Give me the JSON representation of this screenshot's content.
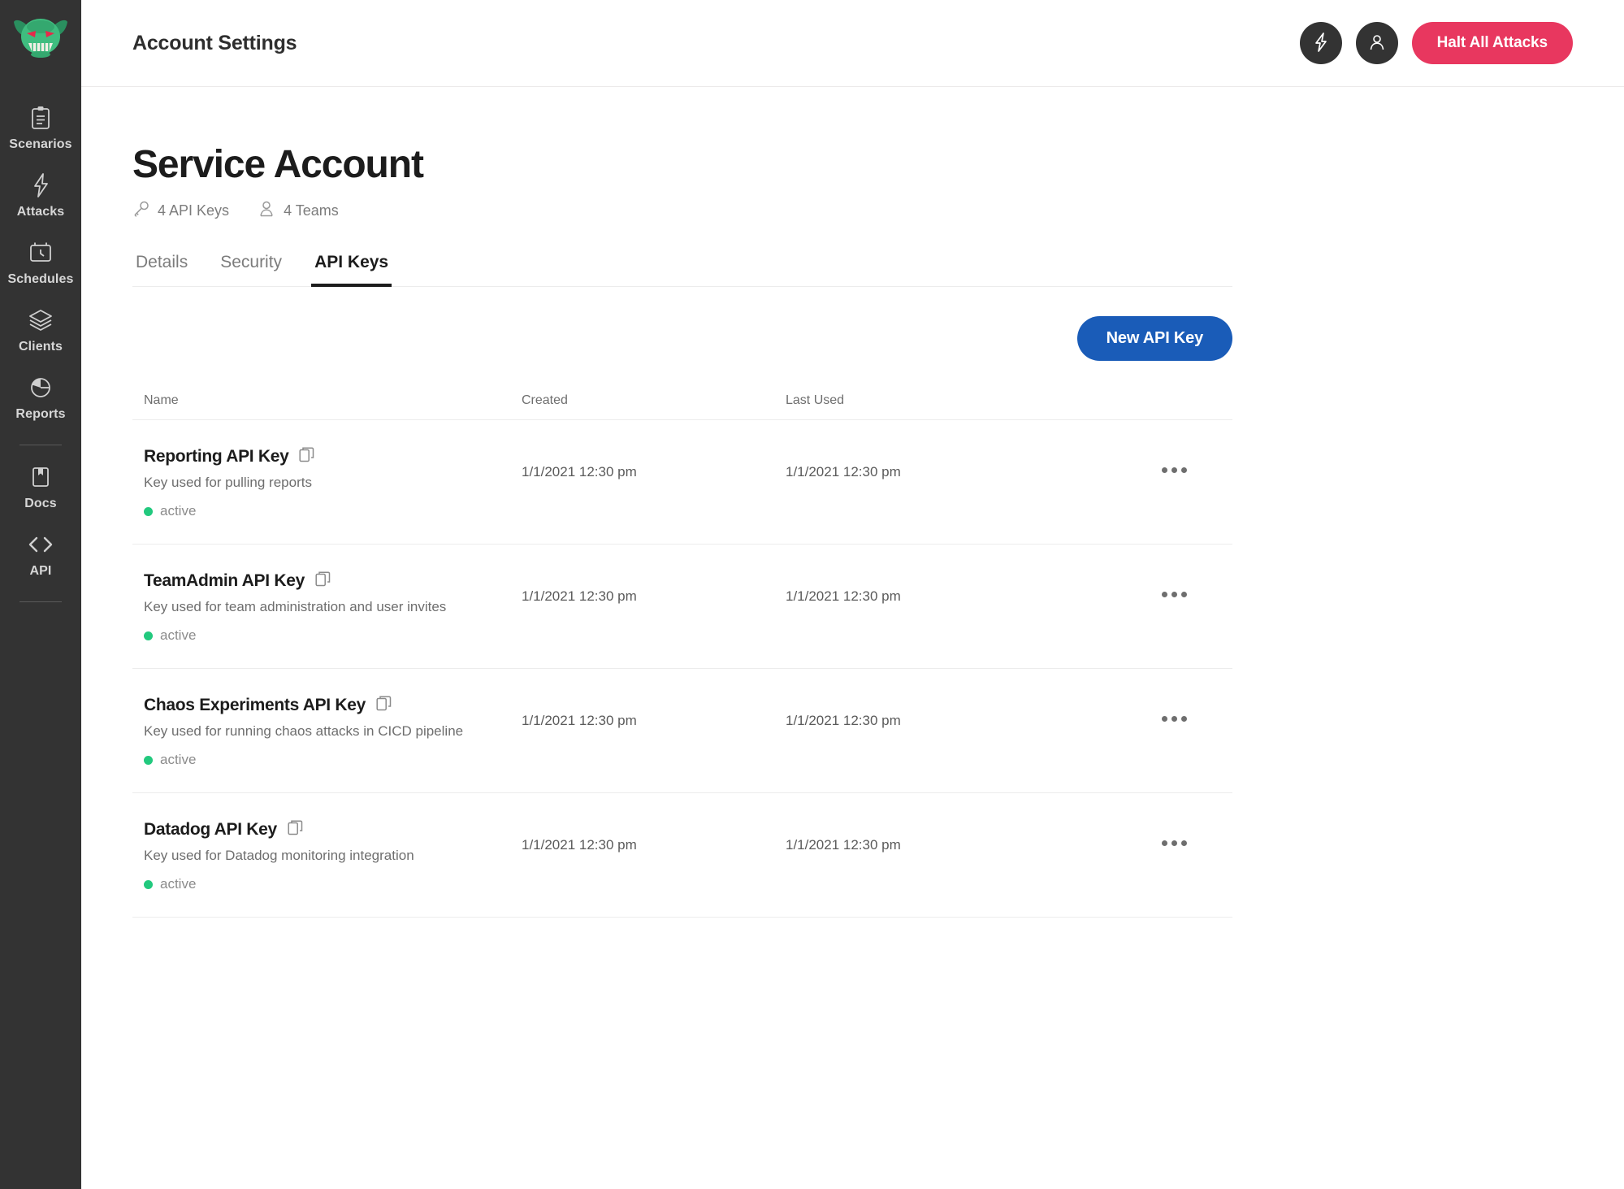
{
  "sidebar": {
    "logo": "goblin-logo",
    "items": [
      {
        "label": "Scenarios",
        "icon": "clipboard-icon"
      },
      {
        "label": "Attacks",
        "icon": "lightning-bolt-icon"
      },
      {
        "label": "Schedules",
        "icon": "calendar-clock-icon"
      },
      {
        "label": "Clients",
        "icon": "layers-icon"
      },
      {
        "label": "Reports",
        "icon": "pie-chart-icon"
      },
      {
        "label": "Docs",
        "icon": "book-icon"
      },
      {
        "label": "API",
        "icon": "code-brackets-icon"
      }
    ]
  },
  "topbar": {
    "title": "Account Settings",
    "bolt_icon": "lightning-bolt-icon",
    "user_icon": "user-icon",
    "halt_label": "Halt All Attacks"
  },
  "page": {
    "title": "Service Account",
    "meta": [
      {
        "icon": "key-icon",
        "text": "4 API Keys"
      },
      {
        "icon": "users-icon",
        "text": "4 Teams"
      }
    ],
    "tabs": [
      {
        "label": "Details",
        "active": false
      },
      {
        "label": "Security",
        "active": false
      },
      {
        "label": "API Keys",
        "active": true
      }
    ],
    "new_key_label": "New API Key"
  },
  "table": {
    "columns": [
      "Name",
      "Created",
      "Last Used"
    ],
    "rows": [
      {
        "name": "Reporting API Key",
        "description": "Key used for pulling reports",
        "status": "active",
        "created": "1/1/2021 12:30 pm",
        "last_used": "1/1/2021 12:30 pm"
      },
      {
        "name": "TeamAdmin API Key",
        "description": "Key used for team administration and user invites",
        "status": "active",
        "created": "1/1/2021 12:30 pm",
        "last_used": "1/1/2021 12:30 pm"
      },
      {
        "name": "Chaos Experiments API Key",
        "description": "Key used for running chaos attacks in CICD pipeline",
        "status": "active",
        "created": "1/1/2021 12:30 pm",
        "last_used": "1/1/2021 12:30 pm"
      },
      {
        "name": "Datadog API Key",
        "description": "Key used for Datadog monitoring integration",
        "status": "active",
        "created": "1/1/2021 12:30 pm",
        "last_used": "1/1/2021 12:30 pm"
      }
    ]
  },
  "colors": {
    "sidebar_bg": "#333333",
    "danger": "#e8375f",
    "primary": "#1a5cb8",
    "status_active": "#22c97e",
    "logo_green": "#2fa86b"
  }
}
